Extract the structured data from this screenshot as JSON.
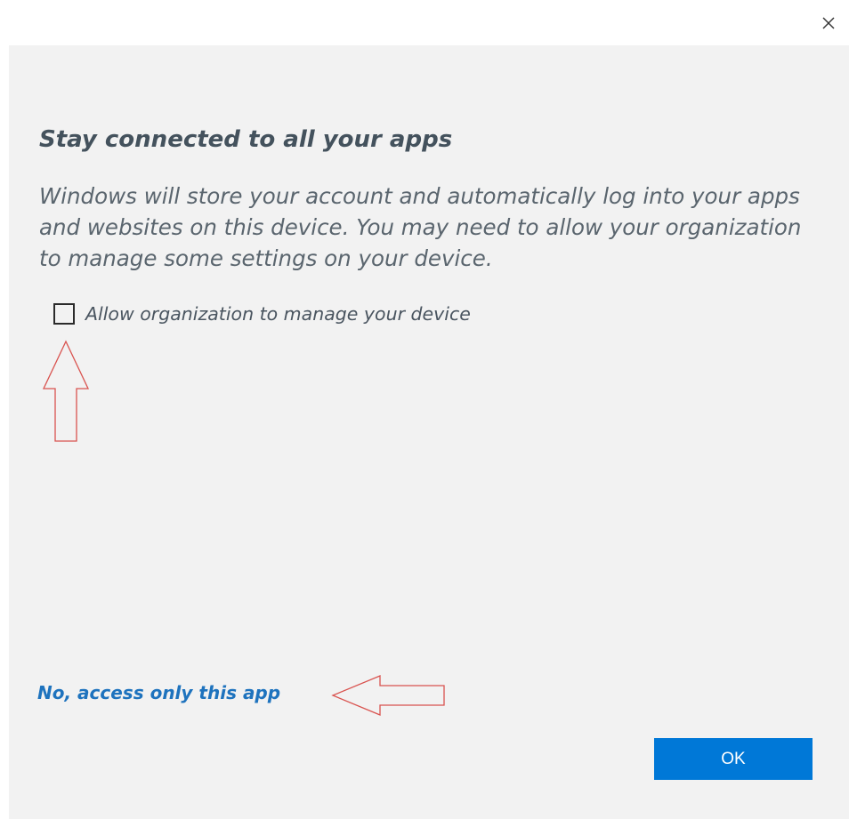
{
  "dialog": {
    "close_icon": "close-icon",
    "heading": "Stay connected to all your apps",
    "body": "Windows will store your account and automatically log into your apps and websites on this device. You may need to allow your organization to manage some settings on your device.",
    "checkbox": {
      "label": "Allow organization to manage your device",
      "checked": false
    },
    "link_label": "No, access only this app",
    "ok_label": "OK"
  },
  "annotations": {
    "color": "#d9534f",
    "arrows": [
      "arrow-up-icon",
      "arrow-left-icon"
    ]
  },
  "colors": {
    "accent": "#0078d7",
    "link": "#1e73be",
    "background": "#f2f2f2"
  }
}
